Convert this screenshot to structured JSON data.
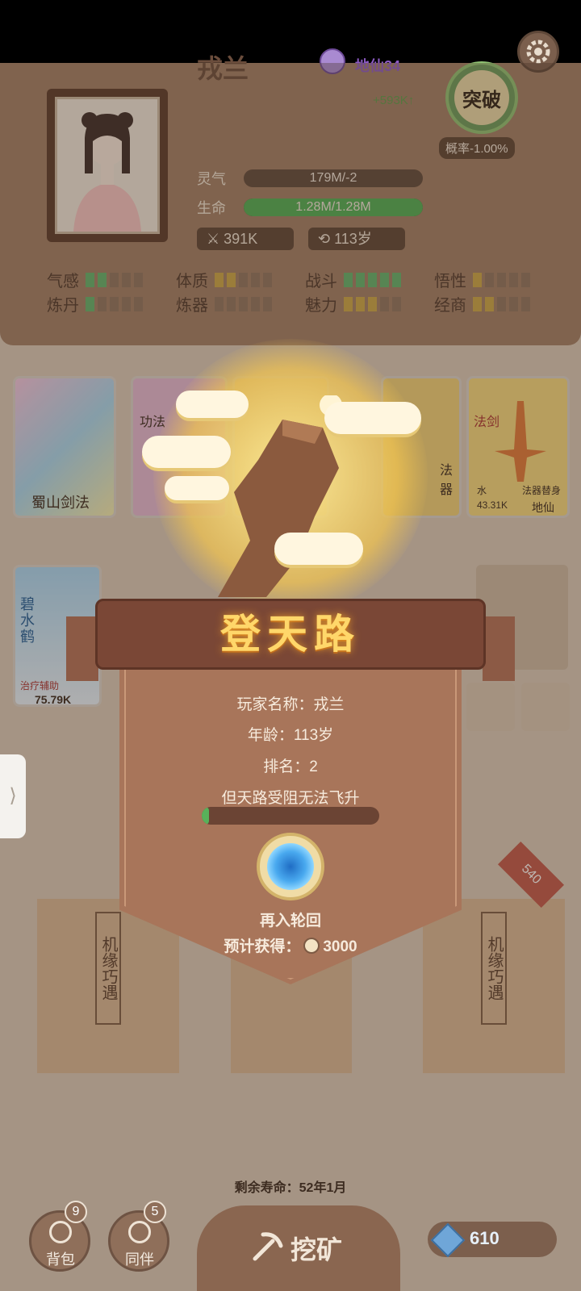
{
  "header": {
    "character_name": "戎兰",
    "rank": "地仙34",
    "gain": "+593K↑",
    "qi_label": "灵气",
    "qi_value": "179M/-2",
    "life_label": "生命",
    "life_value": "1.28M/1.28M",
    "life_fraction": 1.0,
    "power": "391K",
    "age": "113岁",
    "breakthrough_label": "突破",
    "probability": "概率-1.00%"
  },
  "attributes": [
    {
      "label": "气感",
      "filled": 2,
      "color": "g"
    },
    {
      "label": "体质",
      "filled": 2,
      "color": "y"
    },
    {
      "label": "战斗",
      "filled": 5,
      "color": "g"
    },
    {
      "label": "悟性",
      "filled": 1,
      "color": "y"
    },
    {
      "label": "炼丹",
      "filled": 1,
      "color": "g"
    },
    {
      "label": "炼器",
      "filled": 0,
      "color": "g"
    },
    {
      "label": "魅力",
      "filled": 3,
      "color": "y"
    },
    {
      "label": "经商",
      "filled": 2,
      "color": "y"
    }
  ],
  "cards": {
    "card1_name": "蜀山剑法",
    "card2_tag": "功法",
    "card3_tag": "法器",
    "card4_tag": "法剑",
    "card4_element": "水",
    "card4_sub": "法器替身",
    "card4_power": "43.31K",
    "card4_rank": "地仙",
    "card5_name": "碧水鹤",
    "card5_tag": "治疗辅助",
    "card5_power": "75.79K"
  },
  "modal": {
    "title": "登天路",
    "player_name": "玩家名称：戎兰",
    "age": "年龄：113岁",
    "ranking": "排名：2",
    "message": "但天路受阻无法飞升",
    "progress_fraction": 0.04,
    "reincarnate_label": "再入轮回",
    "reward_prefix": "预计获得：",
    "reward_value": "3000"
  },
  "scrolls": {
    "text": "机缘巧遇",
    "badge": "540"
  },
  "bottom": {
    "lifespan": "剩余寿命：52年1月",
    "bag_label": "背包",
    "bag_count": "9",
    "partner_label": "同伴",
    "partner_count": "5",
    "mine_label": "挖矿",
    "gems": "610"
  }
}
